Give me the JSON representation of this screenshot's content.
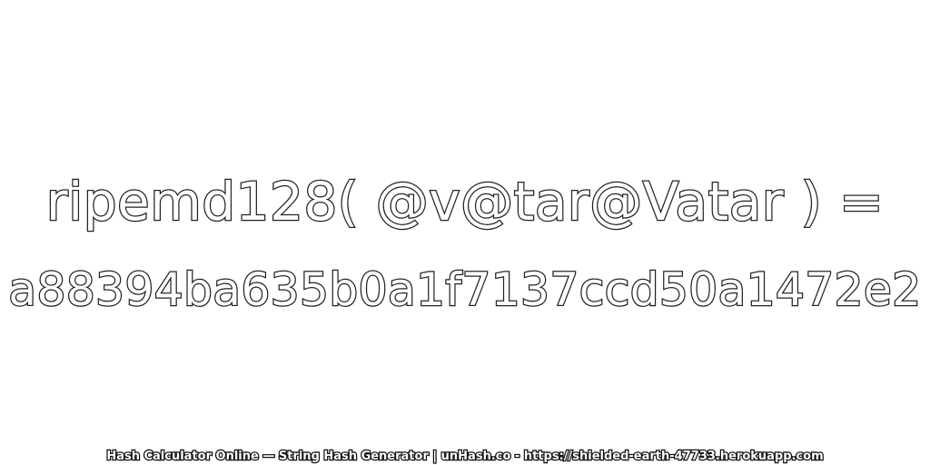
{
  "expression": "ripemd128( @v@tar@Vatar ) =",
  "hash_value": "a88394ba635b0a1f7137ccd50a1472e2",
  "footer_text": "Hash Calculator Online — String Hash Generator | unHash.co - https://shielded-earth-47733.herokuapp.com",
  "colors": {
    "background": "#ffffff",
    "text_fill": "#ffffff",
    "text_outline": "#222222"
  }
}
